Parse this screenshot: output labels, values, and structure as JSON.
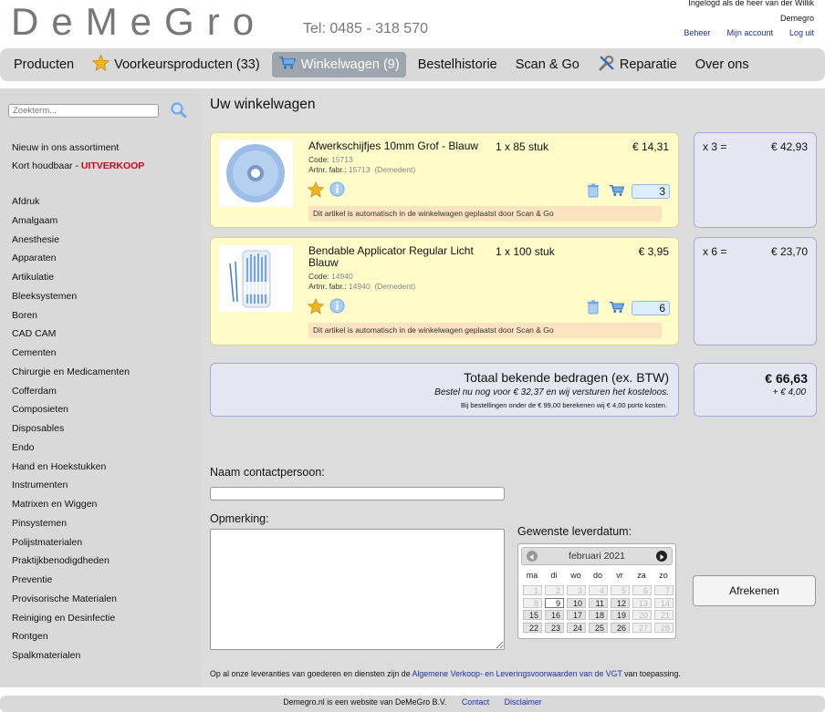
{
  "header": {
    "logo": "DeMeGro",
    "tel": "Tel: 0485 - 318 570",
    "login_status": "Ingelogd als de heer van der Willik",
    "company": "Demegro",
    "links": [
      "Beheer",
      "Mijn account",
      "Log uit"
    ]
  },
  "nav": {
    "items": [
      "Producten",
      "Voorkeursproducten (33)",
      "Winkelwagen (9)",
      "Bestelhistorie",
      "Scan & Go",
      "Reparatie",
      "Over ons"
    ]
  },
  "sidebar": {
    "search_placeholder": "Zoekterm...",
    "special": [
      "Nieuw in ons assortiment",
      "Kort houdbaar - "
    ],
    "uitverkoop": "UITVERKOOP",
    "categories": [
      "Afdruk",
      "Amalgaam",
      "Anesthesie",
      "Apparaten",
      "Artikulatie",
      "Bleeksystemen",
      "Boren",
      "CAD CAM",
      "Cementen",
      "Chirurgie en Medicamenten",
      "Cofferdam",
      "Composieten",
      "Disposables",
      "Endo",
      "Hand en Hoekstukken",
      "Instrumenten",
      "Matrixen en Wiggen",
      "Pinsystemen",
      "Polijstmaterialen",
      "Praktijkbenodigdheden",
      "Preventie",
      "Provisorische Materialen",
      "Reiniging en Desinfectie",
      "Rontgen",
      "Spalkmaterialen"
    ]
  },
  "cart": {
    "title": "Uw winkelwagen",
    "code_label": "Code:",
    "artnr_label": "Artnr. fabr.:",
    "items": [
      {
        "name": "Afwerkschijfjes 10mm Grof - Blauw",
        "qty_desc": "1 x 85 stuk",
        "price": "€ 14,31",
        "code": "15713",
        "artnr": "15713",
        "supplier": "(Demedent)",
        "quantity": "3",
        "note": "Dit artikel is automatisch in de winkelwagen geplaatst door Scan & Go",
        "multiplier": "x 3 =",
        "subtotal": "€ 42,93"
      },
      {
        "name": "Bendable Applicator Regular Licht Blauw",
        "qty_desc": "1 x 100 stuk",
        "price": "€ 3,95",
        "code": "14940",
        "artnr": "14940",
        "supplier": "(Demedent)",
        "quantity": "6",
        "note": "Dit artikel is automatisch in de winkelwagen geplaatst door Scan & Go",
        "multiplier": "x 6 =",
        "subtotal": "€ 23,70"
      }
    ],
    "total_label": "Totaal bekende bedragen (ex. BTW)",
    "free_shipping": "Bestel nu nog voor € 32,37 en wij versturen het kosteloos.",
    "shipping_note": "Bij bestellingen onder de € 99,00 berekenen wij € 4,00 porto kosten.",
    "grand_total": "€ 66,63",
    "porto": "+ € 4,00"
  },
  "form": {
    "contact_label": "Naam contactpersoon:",
    "remark_label": "Opmerking:",
    "date_label": "Gewenste leverdatum:",
    "checkout": "Afrekenen"
  },
  "calendar": {
    "month": "februari 2021",
    "weekdays": [
      "ma",
      "di",
      "wo",
      "do",
      "vr",
      "za",
      "zo"
    ],
    "today": "9",
    "weeks": [
      [
        [
          "1",
          0
        ],
        [
          "2",
          0
        ],
        [
          "3",
          0
        ],
        [
          "4",
          0
        ],
        [
          "5",
          0
        ],
        [
          "6",
          0
        ],
        [
          "7",
          0
        ]
      ],
      [
        [
          "8",
          0
        ],
        [
          "9",
          2
        ],
        [
          "10",
          1
        ],
        [
          "11",
          1
        ],
        [
          "12",
          1
        ],
        [
          "13",
          0
        ],
        [
          "14",
          0
        ]
      ],
      [
        [
          "15",
          1
        ],
        [
          "16",
          1
        ],
        [
          "17",
          1
        ],
        [
          "18",
          1
        ],
        [
          "19",
          1
        ],
        [
          "20",
          0
        ],
        [
          "21",
          0
        ]
      ],
      [
        [
          "22",
          1
        ],
        [
          "23",
          1
        ],
        [
          "24",
          1
        ],
        [
          "25",
          1
        ],
        [
          "26",
          1
        ],
        [
          "27",
          0
        ],
        [
          "28",
          0
        ]
      ]
    ]
  },
  "terms": {
    "before": "Op al onze leveranties van goederen en diensten zijn de ",
    "link": "Algemene Verkoop- en Leveringsvoorwaarden van de VGT",
    "after": " van toepassing."
  },
  "footer": {
    "text": "Demegro.nl is een website van DeMeGro B.V.",
    "links": [
      "Contact",
      "Disclaimer"
    ]
  }
}
